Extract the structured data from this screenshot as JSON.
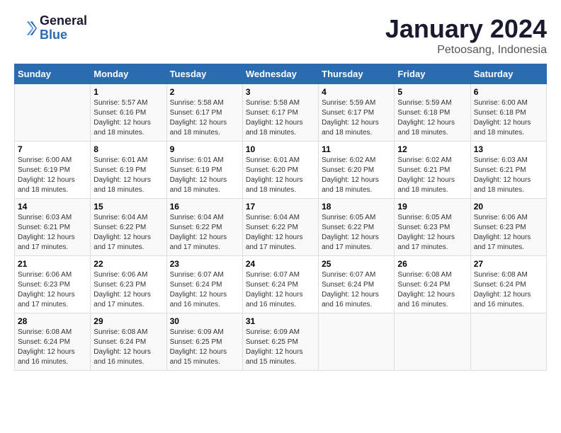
{
  "logo": {
    "line1": "General",
    "line2": "Blue"
  },
  "title": "January 2024",
  "subtitle": "Petoosang, Indonesia",
  "days_header": [
    "Sunday",
    "Monday",
    "Tuesday",
    "Wednesday",
    "Thursday",
    "Friday",
    "Saturday"
  ],
  "weeks": [
    [
      {
        "day": "",
        "sunrise": "",
        "sunset": "",
        "daylight": ""
      },
      {
        "day": "1",
        "sunrise": "Sunrise: 5:57 AM",
        "sunset": "Sunset: 6:16 PM",
        "daylight": "Daylight: 12 hours and 18 minutes."
      },
      {
        "day": "2",
        "sunrise": "Sunrise: 5:58 AM",
        "sunset": "Sunset: 6:17 PM",
        "daylight": "Daylight: 12 hours and 18 minutes."
      },
      {
        "day": "3",
        "sunrise": "Sunrise: 5:58 AM",
        "sunset": "Sunset: 6:17 PM",
        "daylight": "Daylight: 12 hours and 18 minutes."
      },
      {
        "day": "4",
        "sunrise": "Sunrise: 5:59 AM",
        "sunset": "Sunset: 6:17 PM",
        "daylight": "Daylight: 12 hours and 18 minutes."
      },
      {
        "day": "5",
        "sunrise": "Sunrise: 5:59 AM",
        "sunset": "Sunset: 6:18 PM",
        "daylight": "Daylight: 12 hours and 18 minutes."
      },
      {
        "day": "6",
        "sunrise": "Sunrise: 6:00 AM",
        "sunset": "Sunset: 6:18 PM",
        "daylight": "Daylight: 12 hours and 18 minutes."
      }
    ],
    [
      {
        "day": "7",
        "sunrise": "Sunrise: 6:00 AM",
        "sunset": "Sunset: 6:19 PM",
        "daylight": "Daylight: 12 hours and 18 minutes."
      },
      {
        "day": "8",
        "sunrise": "Sunrise: 6:01 AM",
        "sunset": "Sunset: 6:19 PM",
        "daylight": "Daylight: 12 hours and 18 minutes."
      },
      {
        "day": "9",
        "sunrise": "Sunrise: 6:01 AM",
        "sunset": "Sunset: 6:19 PM",
        "daylight": "Daylight: 12 hours and 18 minutes."
      },
      {
        "day": "10",
        "sunrise": "Sunrise: 6:01 AM",
        "sunset": "Sunset: 6:20 PM",
        "daylight": "Daylight: 12 hours and 18 minutes."
      },
      {
        "day": "11",
        "sunrise": "Sunrise: 6:02 AM",
        "sunset": "Sunset: 6:20 PM",
        "daylight": "Daylight: 12 hours and 18 minutes."
      },
      {
        "day": "12",
        "sunrise": "Sunrise: 6:02 AM",
        "sunset": "Sunset: 6:21 PM",
        "daylight": "Daylight: 12 hours and 18 minutes."
      },
      {
        "day": "13",
        "sunrise": "Sunrise: 6:03 AM",
        "sunset": "Sunset: 6:21 PM",
        "daylight": "Daylight: 12 hours and 18 minutes."
      }
    ],
    [
      {
        "day": "14",
        "sunrise": "Sunrise: 6:03 AM",
        "sunset": "Sunset: 6:21 PM",
        "daylight": "Daylight: 12 hours and 17 minutes."
      },
      {
        "day": "15",
        "sunrise": "Sunrise: 6:04 AM",
        "sunset": "Sunset: 6:22 PM",
        "daylight": "Daylight: 12 hours and 17 minutes."
      },
      {
        "day": "16",
        "sunrise": "Sunrise: 6:04 AM",
        "sunset": "Sunset: 6:22 PM",
        "daylight": "Daylight: 12 hours and 17 minutes."
      },
      {
        "day": "17",
        "sunrise": "Sunrise: 6:04 AM",
        "sunset": "Sunset: 6:22 PM",
        "daylight": "Daylight: 12 hours and 17 minutes."
      },
      {
        "day": "18",
        "sunrise": "Sunrise: 6:05 AM",
        "sunset": "Sunset: 6:22 PM",
        "daylight": "Daylight: 12 hours and 17 minutes."
      },
      {
        "day": "19",
        "sunrise": "Sunrise: 6:05 AM",
        "sunset": "Sunset: 6:23 PM",
        "daylight": "Daylight: 12 hours and 17 minutes."
      },
      {
        "day": "20",
        "sunrise": "Sunrise: 6:06 AM",
        "sunset": "Sunset: 6:23 PM",
        "daylight": "Daylight: 12 hours and 17 minutes."
      }
    ],
    [
      {
        "day": "21",
        "sunrise": "Sunrise: 6:06 AM",
        "sunset": "Sunset: 6:23 PM",
        "daylight": "Daylight: 12 hours and 17 minutes."
      },
      {
        "day": "22",
        "sunrise": "Sunrise: 6:06 AM",
        "sunset": "Sunset: 6:23 PM",
        "daylight": "Daylight: 12 hours and 17 minutes."
      },
      {
        "day": "23",
        "sunrise": "Sunrise: 6:07 AM",
        "sunset": "Sunset: 6:24 PM",
        "daylight": "Daylight: 12 hours and 16 minutes."
      },
      {
        "day": "24",
        "sunrise": "Sunrise: 6:07 AM",
        "sunset": "Sunset: 6:24 PM",
        "daylight": "Daylight: 12 hours and 16 minutes."
      },
      {
        "day": "25",
        "sunrise": "Sunrise: 6:07 AM",
        "sunset": "Sunset: 6:24 PM",
        "daylight": "Daylight: 12 hours and 16 minutes."
      },
      {
        "day": "26",
        "sunrise": "Sunrise: 6:08 AM",
        "sunset": "Sunset: 6:24 PM",
        "daylight": "Daylight: 12 hours and 16 minutes."
      },
      {
        "day": "27",
        "sunrise": "Sunrise: 6:08 AM",
        "sunset": "Sunset: 6:24 PM",
        "daylight": "Daylight: 12 hours and 16 minutes."
      }
    ],
    [
      {
        "day": "28",
        "sunrise": "Sunrise: 6:08 AM",
        "sunset": "Sunset: 6:24 PM",
        "daylight": "Daylight: 12 hours and 16 minutes."
      },
      {
        "day": "29",
        "sunrise": "Sunrise: 6:08 AM",
        "sunset": "Sunset: 6:24 PM",
        "daylight": "Daylight: 12 hours and 16 minutes."
      },
      {
        "day": "30",
        "sunrise": "Sunrise: 6:09 AM",
        "sunset": "Sunset: 6:25 PM",
        "daylight": "Daylight: 12 hours and 15 minutes."
      },
      {
        "day": "31",
        "sunrise": "Sunrise: 6:09 AM",
        "sunset": "Sunset: 6:25 PM",
        "daylight": "Daylight: 12 hours and 15 minutes."
      },
      {
        "day": "",
        "sunrise": "",
        "sunset": "",
        "daylight": ""
      },
      {
        "day": "",
        "sunrise": "",
        "sunset": "",
        "daylight": ""
      },
      {
        "day": "",
        "sunrise": "",
        "sunset": "",
        "daylight": ""
      }
    ]
  ]
}
